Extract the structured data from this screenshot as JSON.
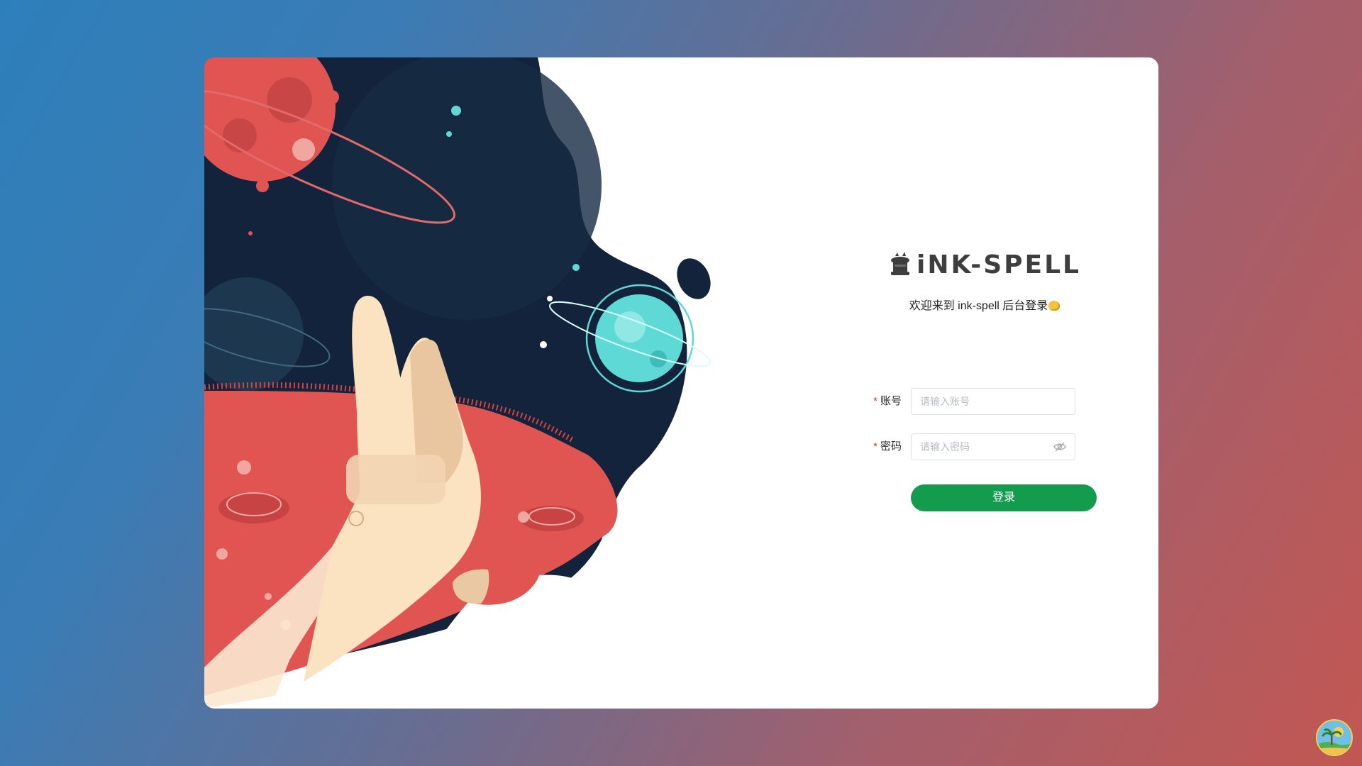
{
  "app": {
    "logo_text": "iNK-SPELL",
    "welcome_text": "欢迎来到 ink-spell 后台登录"
  },
  "form": {
    "account_label": "账号",
    "account_placeholder": "请输入账号",
    "password_label": "密码",
    "password_placeholder": "请输入密码",
    "required_mark": "*",
    "submit_label": "登录"
  },
  "icons": {
    "logo": "magic-hat-icon",
    "welcome_emoji": "fist-emoji-icon",
    "password_toggle": "eye-off-icon",
    "corner_avatar": "island-avatar-icon"
  },
  "colors": {
    "primary_button": "#139b4e",
    "required": "#e0342f",
    "illus_dark": "#13233b",
    "illus_red": "#e05552"
  }
}
